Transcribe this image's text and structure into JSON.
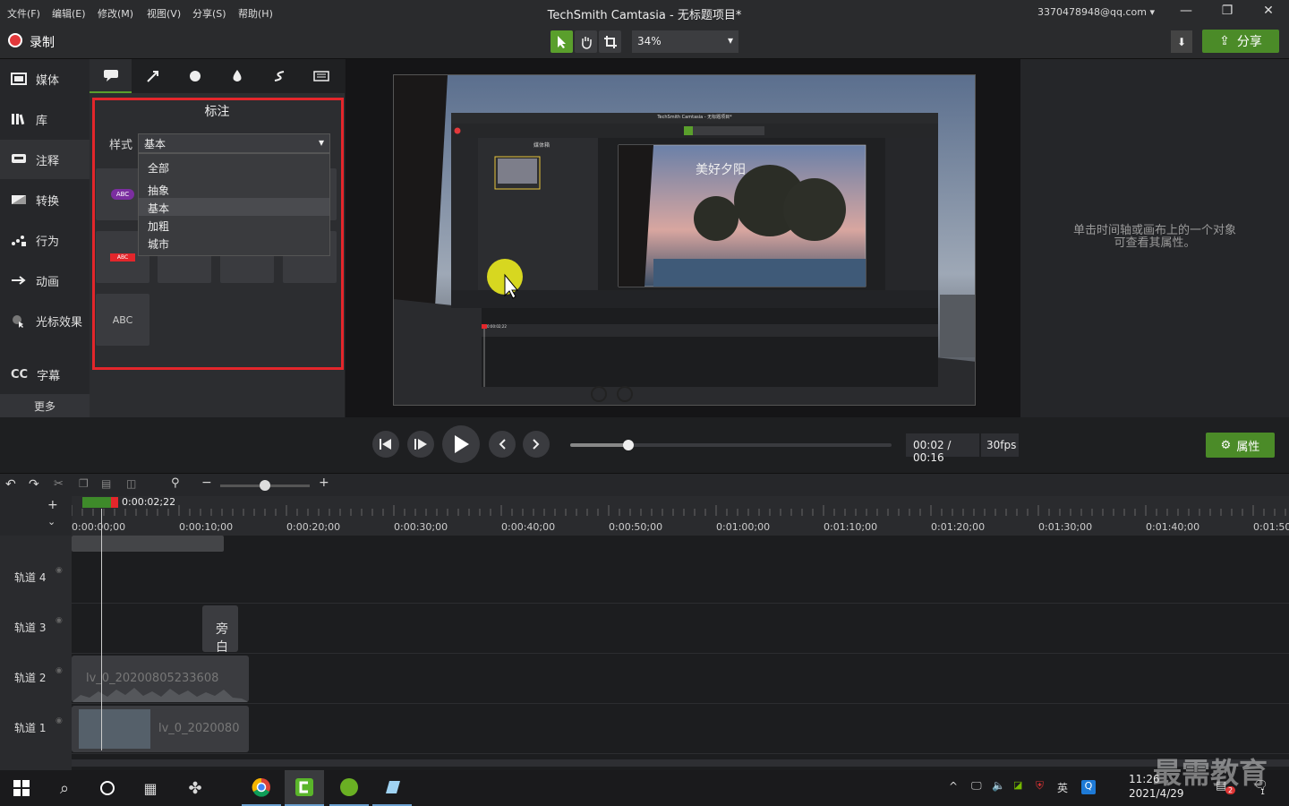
{
  "menu": [
    "文件(F)",
    "编辑(E)",
    "修改(M)",
    "视图(V)",
    "分享(S)",
    "帮助(H)"
  ],
  "window_title": "TechSmith Camtasia - 无标题项目*",
  "account": "3370478948@qq.com",
  "record_label": "录制",
  "zoom_value": "34%",
  "share_label": "分享",
  "sidebar": {
    "items": [
      {
        "label": "媒体",
        "icon": "media-icon"
      },
      {
        "label": "库",
        "icon": "library-icon"
      },
      {
        "label": "注释",
        "icon": "annotation-icon"
      },
      {
        "label": "转换",
        "icon": "transition-icon"
      },
      {
        "label": "行为",
        "icon": "behavior-icon"
      },
      {
        "label": "动画",
        "icon": "animation-icon"
      },
      {
        "label": "光标效果",
        "icon": "cursor-effect-icon"
      },
      {
        "label": "字幕",
        "icon": "caption-icon"
      }
    ],
    "more": "更多"
  },
  "panel": {
    "title": "标注",
    "style_label": "样式",
    "style_value": "基本",
    "options": [
      "全部",
      "抽象",
      "基本",
      "加粗",
      "城市"
    ],
    "tile_text": "ABC"
  },
  "canvas_preview": {
    "inner_title": "TechSmith Camtasia - 无标题项目*",
    "inner_panel_label": "媒体箱",
    "overlay_text": "美好夕阳",
    "inner_time": "0:00:02;22"
  },
  "properties_hint": [
    "单击时间轴或画布上的一个对象",
    "可查看其属性。"
  ],
  "playback": {
    "time": "00:02 / 00:16",
    "fps": "30fps",
    "properties_label": "属性",
    "scrub_fraction": 0.18
  },
  "timeline": {
    "playhead_time": "0:00:02;22",
    "ticks": [
      "0:00:00;00",
      "0:00:10;00",
      "0:00:20;00",
      "0:00:30;00",
      "0:00:40;00",
      "0:00:50;00",
      "0:01:00;00",
      "0:01:10;00",
      "0:01:20;00",
      "0:01:30;00",
      "0:01:40;00",
      "0:01:50;"
    ],
    "tracks": [
      "轨道 4",
      "轨道 3",
      "轨道 2",
      "轨道 1"
    ],
    "clip_track3": "旁白",
    "clip_track2": "lv_0_20200805233608",
    "clip_track1": "lv_0_2020080"
  },
  "taskbar": {
    "time": "11:26",
    "date": "2021/4/29",
    "ime": "英",
    "watermark": "最需教育",
    "notif_count": "2",
    "msg_count": "1"
  },
  "colors": {
    "accent_green": "#4b8b28",
    "record_red": "#e2383b",
    "highlight_red": "#e3262b"
  }
}
